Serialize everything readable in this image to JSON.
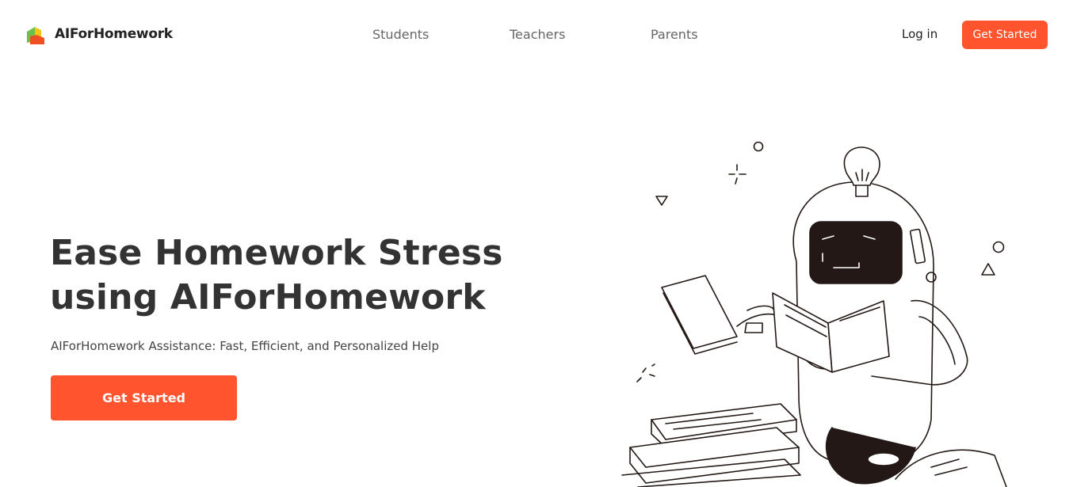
{
  "header": {
    "brand_name": "AIForHomework",
    "nav": {
      "students": "Students",
      "teachers": "Teachers",
      "parents": "Parents"
    },
    "login_label": "Log in",
    "cta_label": "Get Started"
  },
  "hero": {
    "title_line1": "Ease Homework Stress",
    "title_line2": "using AIForHomework",
    "subtitle": "AIForHomework Assistance: Fast, Efficient, and Personalized Help",
    "cta_label": "Get Started"
  },
  "colors": {
    "accent": "#ff542e",
    "logo_green": "#6cc04a",
    "logo_yellow": "#f5c518",
    "logo_red": "#f04e23"
  }
}
